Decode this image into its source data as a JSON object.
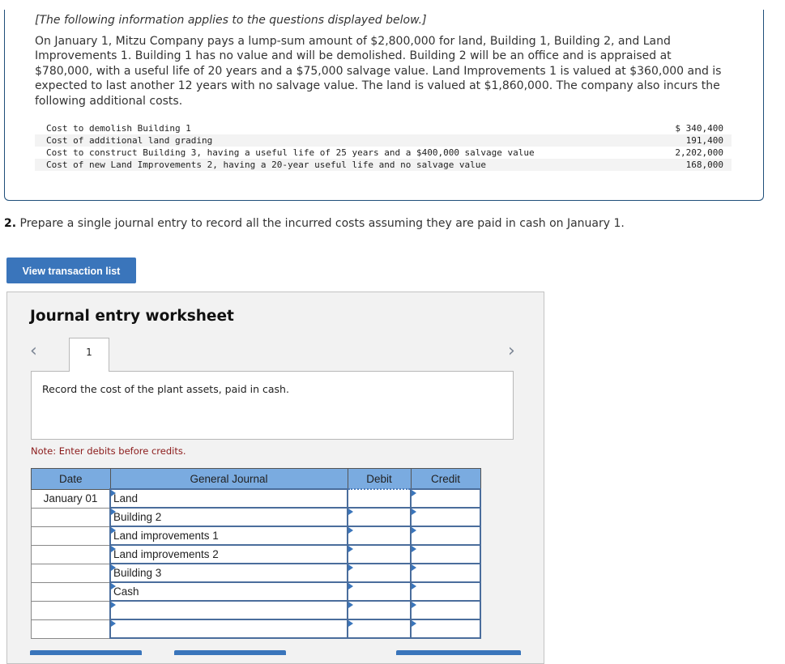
{
  "intro": "[The following information applies to the questions displayed below.]",
  "paragraph": "On January 1, Mitzu Company pays a lump-sum amount of $2,800,000 for land, Building 1, Building 2, and Land Improvements 1. Building 1 has no value and will be demolished. Building 2 will be an office and is appraised at $780,000, with a useful life of 20 years and a $75,000 salvage value. Land Improvements 1 is valued at $360,000 and is expected to last another 12 years with no salvage value. The land is valued at $1,860,000. The company also incurs the following additional costs.",
  "costs": [
    {
      "label": "Cost to demolish Building 1",
      "amount": "$ 340,400"
    },
    {
      "label": "Cost of additional land grading",
      "amount": "191,400"
    },
    {
      "label": "Cost to construct Building 3, having a useful life of 25 years and a $400,000 salvage value",
      "amount": "2,202,000"
    },
    {
      "label": "Cost of new Land Improvements 2, having a 20-year useful life and no salvage value",
      "amount": "168,000"
    }
  ],
  "question": {
    "number": "2.",
    "text": " Prepare a single journal entry to record all the incurred costs assuming they are paid in cash on January 1."
  },
  "view_transaction_button": "View transaction list",
  "worksheet": {
    "title": "Journal entry worksheet",
    "prev_icon": "‹",
    "next_icon": "›",
    "active_tab": "1",
    "description": "Record the cost of the plant assets, paid in cash.",
    "note": "Note: Enter debits before credits.",
    "columns": [
      "Date",
      "General Journal",
      "Debit",
      "Credit"
    ],
    "rows": [
      {
        "date": "January 01",
        "account": "Land",
        "debit": "",
        "credit": ""
      },
      {
        "date": "",
        "account": "Building 2",
        "debit": "",
        "credit": ""
      },
      {
        "date": "",
        "account": "Land improvements 1",
        "debit": "",
        "credit": ""
      },
      {
        "date": "",
        "account": "Land improvements 2",
        "debit": "",
        "credit": ""
      },
      {
        "date": "",
        "account": "Building 3",
        "debit": "",
        "credit": ""
      },
      {
        "date": "",
        "account": "Cash",
        "debit": "",
        "credit": ""
      },
      {
        "date": "",
        "account": "",
        "debit": "",
        "credit": ""
      },
      {
        "date": "",
        "account": "",
        "debit": "",
        "credit": ""
      }
    ]
  },
  "colors": {
    "accent": "#3a75bb",
    "header_blue": "#7aabe0",
    "note_red": "#8b1a1a",
    "info_border": "#1f4e79"
  }
}
